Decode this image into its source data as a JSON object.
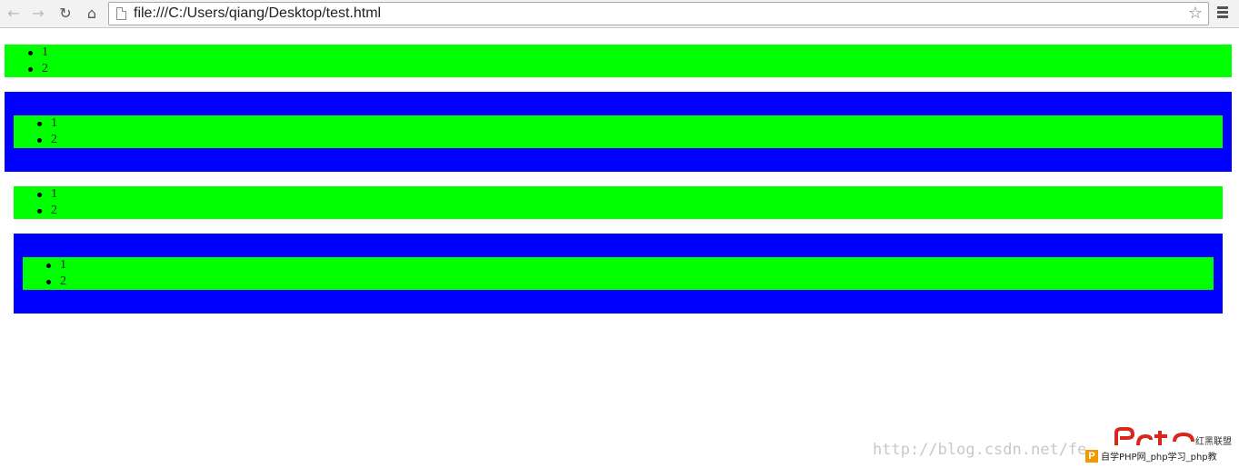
{
  "browser": {
    "url": "file:///C:/Users/qiang/Desktop/test.html",
    "icons": {
      "back": "back-arrow-icon",
      "forward": "forward-arrow-icon",
      "reload": "reload-icon",
      "home": "home-icon",
      "page": "page-icon",
      "bookmark": "star-icon",
      "menu": "menu-icon"
    }
  },
  "colors": {
    "green": "#00ff00",
    "blue": "#0000ff"
  },
  "blocks": [
    {
      "items": [
        "1",
        "2"
      ]
    },
    {
      "items": [
        "1",
        "2"
      ]
    },
    {
      "items": [
        "1",
        "2"
      ]
    },
    {
      "items": [
        "1",
        "2"
      ]
    }
  ],
  "watermark": {
    "url_text": "http://blog.csdn.net/fe",
    "brand": "红黑联盟",
    "promo": "自学PHP网_php学习_php教"
  }
}
